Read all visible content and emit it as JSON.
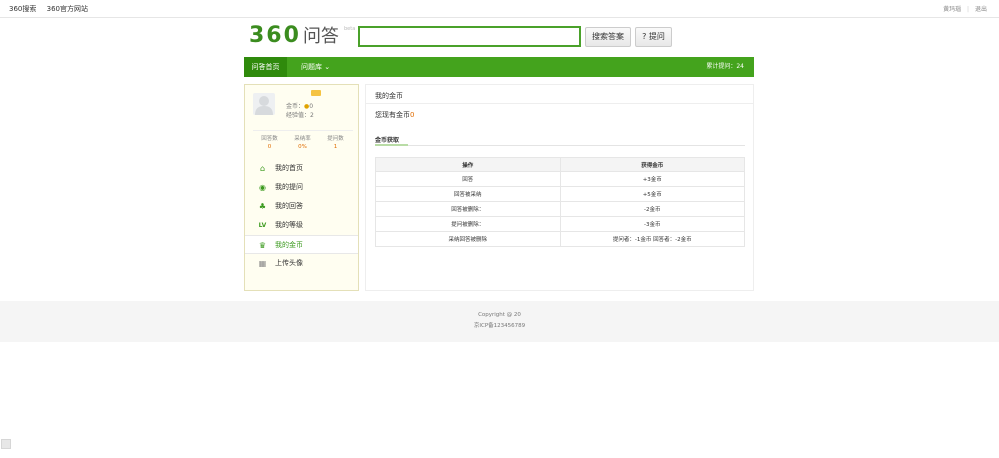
{
  "topbar": {
    "left_links": [
      "360搜索",
      "360官方网站"
    ],
    "user_name": "黄玛瑙",
    "separator": "|",
    "logout": "退出"
  },
  "header": {
    "logo_number": "360",
    "logo_text": "问答",
    "logo_badge": "beta",
    "search_value": "",
    "search_button": "搜索答案",
    "ask_button": "? 提问"
  },
  "nav": {
    "home": "问答首页",
    "library": "问题库",
    "dropdown_glyph": "⌄",
    "count_label": "累计提问：",
    "count_value": "24"
  },
  "profile": {
    "coin_label": "金币：",
    "coin_value": "0",
    "exp_label": "经验值：",
    "exp_value": "2",
    "stats": [
      {
        "label": "回答数",
        "value": "0"
      },
      {
        "label": "采纳率",
        "value": "0%"
      },
      {
        "label": "提问数",
        "value": "1"
      }
    ]
  },
  "menu": [
    {
      "label": "我的首页",
      "icon": "home-icon",
      "glyph": "⌂"
    },
    {
      "label": "我的提问",
      "icon": "question-icon",
      "glyph": "◉"
    },
    {
      "label": "我的回答",
      "icon": "user-answer-icon",
      "glyph": "♣"
    },
    {
      "label": "我的等级",
      "icon": "level-icon",
      "glyph": "LV"
    },
    {
      "label": "我的金币",
      "icon": "coin-icon",
      "glyph": "♛"
    },
    {
      "label": "上传头像",
      "icon": "image-icon",
      "glyph": "▦"
    }
  ],
  "content": {
    "title": "我的金币",
    "balance_text": "您现有金币",
    "balance_value": "0",
    "section_title": "金币获取",
    "table_headers": [
      "操作",
      "获得金币"
    ],
    "rows": [
      [
        "回答",
        "+3金币"
      ],
      [
        "回答被采纳",
        "+5金币"
      ],
      [
        "回答被删除：",
        "-2金币"
      ],
      [
        "提问被删除：",
        "-3金币"
      ],
      [
        "采纳回答被删除",
        "提问者：-1金币  回答者：-2金币"
      ]
    ]
  },
  "footer": {
    "copyright": "Copyright @ 20",
    "icp": "京ICP备123456789"
  },
  "colors": {
    "brand_green": "#44a31d",
    "nav_active": "#2f8a0c",
    "accent_orange": "#e06c00"
  }
}
